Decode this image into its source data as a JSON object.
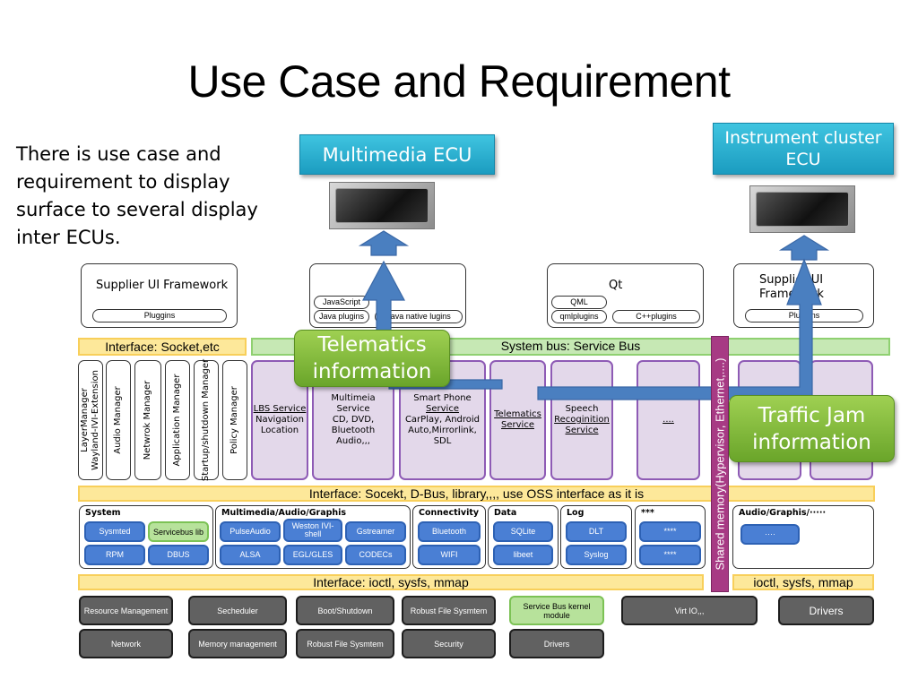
{
  "slide": {
    "title": "Use Case and Requirement",
    "intro_text": "There is use case and requirement to display surface to several display inter ECUs."
  },
  "ecus": {
    "multimedia": "Multimedia ECU",
    "instrument_cluster_line1": "Instrument cluster",
    "instrument_cluster_line2": "ECU"
  },
  "frameworks": {
    "supplier_left": {
      "title": "Supplier UI Framework",
      "plugins": "Pluggins"
    },
    "java": {
      "javascript": "JavaScript",
      "java_plugins": "Java plugins",
      "java_native": "Java native lugins"
    },
    "qt": {
      "title": "Qt",
      "qml": "QML",
      "qmlplugins": "qmlplugins",
      "cpp_plugins": "C++plugins"
    },
    "supplier_right": {
      "title_line1": "Supplier UI",
      "title_line2": "Framework",
      "plugins": "Pluggins"
    }
  },
  "bars": {
    "interface_socket": "Interface: Socket,etc",
    "system_bus": "System bus: Service Bus",
    "interface_oss": "Interface: Socekt, D-Bus, library,,,, use OSS interface as it is",
    "interface_ioctl": "Interface: ioctl, sysfs, mmap",
    "ioctl_right": "ioctl, sysfs, mmap",
    "shared_memory": "Shared memory(Hypervisor, Ethernet,....)"
  },
  "managers": [
    {
      "line1": "LayerManager",
      "line2": "Wayland-IVI-Extension"
    },
    {
      "line1": "Audio Manager",
      "line2": ""
    },
    {
      "line1": "Netwrok Manager",
      "line2": ""
    },
    {
      "line1": "Application Manager",
      "line2": ""
    },
    {
      "line1": "Startup/shutdown Manager",
      "line2": ""
    },
    {
      "line1": "Policy Manager",
      "line2": ""
    }
  ],
  "services": [
    {
      "l1": "LBS Service",
      "l2": "Navigation",
      "l3": "Location",
      "l4": ""
    },
    {
      "l1": "Multimeia Service",
      "l2": "CD, DVD,",
      "l3": "Bluetooth Audio,,,",
      "l4": ""
    },
    {
      "l1": "Smart Phone",
      "l2": "Service",
      "l3": "CarPlay, Android",
      "l4": "Auto,Mirrorlink, SDL"
    },
    {
      "l1": "Telematics",
      "l2": "Service",
      "l3": "",
      "l4": ""
    },
    {
      "l1": "Speech",
      "l2": "Recoginition",
      "l3": "Service",
      "l4": ""
    },
    {
      "l1": "....",
      "l2": "",
      "l3": "",
      "l4": ""
    }
  ],
  "middleware": {
    "system": {
      "title": "System",
      "items": [
        "Sysmted",
        "Servicebus lib",
        "RPM",
        "DBUS"
      ]
    },
    "multimedia": {
      "title": "Multimedia/Audio/Graphis",
      "items": [
        "PulseAudio",
        "Weston IVI-shell",
        "Gstreamer",
        "ALSA",
        "EGL/GLES",
        "CODECs"
      ]
    },
    "connectivity": {
      "title": "Connectivity",
      "items": [
        "Bluetooth",
        "WIFI"
      ]
    },
    "data": {
      "title": "Data",
      "items": [
        "SQLite",
        "libeet"
      ]
    },
    "log": {
      "title": "Log",
      "items": [
        "DLT",
        "Syslog"
      ]
    },
    "other": {
      "title": "***",
      "items": [
        "****",
        "****"
      ]
    },
    "right": {
      "title": "Audio/Graphis/·····",
      "items": [
        "····"
      ]
    }
  },
  "kernel": {
    "row1": [
      "Resource Management",
      "Secheduler",
      "Boot/Shutdown",
      "Robust File Sysmtem",
      "Service Bus kernel module",
      "Virt IO,,,",
      "Drivers"
    ],
    "row2": [
      "Network",
      "Memory management",
      "Robust File Sysmtem",
      "Security",
      "Drivers"
    ]
  },
  "callouts": {
    "telematics_line1": "Telematics",
    "telematics_line2": "information",
    "traffic_line1": "Traffic Jam",
    "traffic_line2": "information"
  },
  "colors": {
    "ecu_blue": "#1b9cc0",
    "arrow_blue": "#4a7fc0",
    "callout_green": "#7cb83a",
    "service_purple": "#8e5bb5",
    "interface_yellow": "#fde89a",
    "bus_green": "#c6e8b4",
    "shared_memory_magenta": "#a73a84",
    "kernel_gray": "#616161"
  }
}
